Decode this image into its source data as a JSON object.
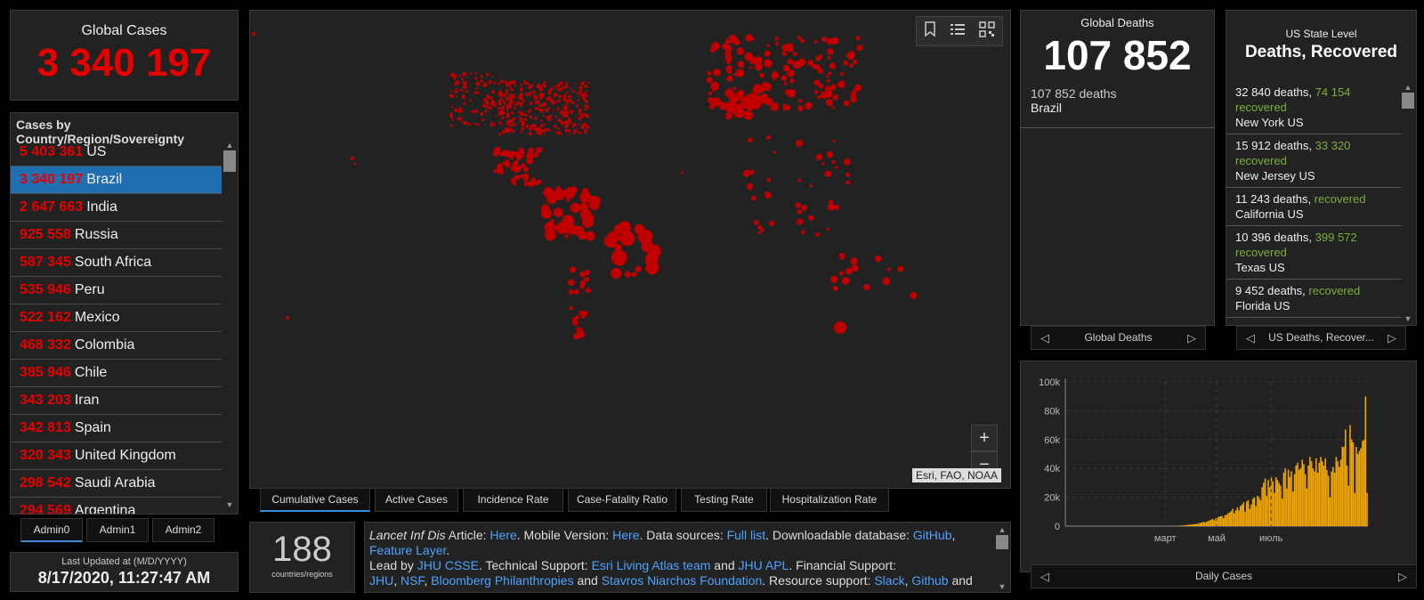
{
  "global_cases": {
    "label": "Global Cases",
    "value": "3 340 197"
  },
  "country_list": {
    "header": "Cases by Country/Region/Sovereignty",
    "items": [
      {
        "count": "5 403 361",
        "name": "US"
      },
      {
        "count": "3 340 197",
        "name": "Brazil",
        "selected": true
      },
      {
        "count": "2 647 663",
        "name": "India"
      },
      {
        "count": "925 558",
        "name": "Russia"
      },
      {
        "count": "587 345",
        "name": "South Africa"
      },
      {
        "count": "535 946",
        "name": "Peru"
      },
      {
        "count": "522 162",
        "name": "Mexico"
      },
      {
        "count": "468 332",
        "name": "Colombia"
      },
      {
        "count": "385 946",
        "name": "Chile"
      },
      {
        "count": "343 203",
        "name": "Iran"
      },
      {
        "count": "342 813",
        "name": "Spain"
      },
      {
        "count": "320 343",
        "name": "United Kingdom"
      },
      {
        "count": "298 542",
        "name": "Saudi Arabia"
      },
      {
        "count": "294 569",
        "name": "Argentina"
      }
    ]
  },
  "admin_tabs": [
    "Admin0",
    "Admin1",
    "Admin2"
  ],
  "last_updated": {
    "label": "Last Updated at (M/D/YYYY)",
    "value": "8/17/2020, 11:27:47 AM"
  },
  "map": {
    "attribution": "Esri, FAO, NOAA",
    "zoom_in": "+",
    "zoom_out": "−",
    "tabs": [
      "Cumulative Cases",
      "Active Cases",
      "Incidence Rate",
      "Case-Fatality Ratio",
      "Testing Rate",
      "Hospitalization Rate"
    ],
    "active_tab": 0
  },
  "countries_count": {
    "value": "188",
    "label": "countries/regions"
  },
  "info": {
    "t1": "Lancet Inf Dis",
    "t2": " Article: ",
    "l1": "Here",
    "t3": ". Mobile Version: ",
    "l2": "Here",
    "t4": ". Data sources: ",
    "l3": "Full list",
    "t5": ". Downloadable database: ",
    "l4": "GitHub",
    "t6": ", ",
    "l5": "Feature Layer",
    "t7": ".",
    "t8": "Lead by ",
    "l6": "JHU CSSE",
    "t9": ". Technical Support: ",
    "l7": "Esri Living Atlas team",
    "t10": " and ",
    "l8": "JHU APL",
    "t11": ". Financial Support:",
    "l9": "JHU",
    "t12": ", ",
    "l10": "NSF",
    "t13": ", ",
    "l11": "Bloomberg Philanthropies",
    "t14": " and ",
    "l12": "Stavros Niarchos Foundation",
    "t15": ". Resource support: ",
    "l13": "Slack",
    "t16": ", ",
    "l14": "Github",
    "t17": " and"
  },
  "global_deaths": {
    "label": "Global Deaths",
    "value": "107 852",
    "detail_count": "107 852 deaths",
    "detail_country": "Brazil",
    "pager_label": "Global Deaths"
  },
  "us_state": {
    "label": "US State Level",
    "title": "Deaths, Recovered",
    "items": [
      {
        "deaths": "32 840 deaths, ",
        "recovered": "74 154 recovered",
        "place": "New York US"
      },
      {
        "deaths": "15 912 deaths, ",
        "recovered": "33 320 recovered",
        "place": "New Jersey US"
      },
      {
        "deaths": "11 243 deaths, ",
        "recovered": " recovered",
        "place": "California US"
      },
      {
        "deaths": "10 396 deaths, ",
        "recovered": "399 572 recovered",
        "place": "Texas US"
      },
      {
        "deaths": "9 452 deaths, ",
        "recovered": " recovered",
        "place": "Florida US"
      }
    ],
    "pager_label": "US Deaths, Recover..."
  },
  "chart_pager_label": "Daily Cases",
  "colors": {
    "accent_red": "#e60000",
    "bar": "#f5a800",
    "link": "#4da3ff",
    "recovered": "#7ab03a",
    "tab_active": "#3b8ddb"
  },
  "icons": [
    "bookmark-icon",
    "legend-list-icon",
    "qr-grid-icon",
    "chevron-left-icon",
    "chevron-right-icon"
  ],
  "chart_data": {
    "type": "bar",
    "y_ticks": [
      "0",
      "20k",
      "40k",
      "60k",
      "80k",
      "100k"
    ],
    "x_ticks": [
      "март",
      "май",
      "июль"
    ],
    "ylim": [
      0,
      100000
    ],
    "values": [
      0,
      0,
      0,
      0,
      0,
      0,
      0,
      0,
      0,
      0,
      0,
      0,
      0,
      0,
      0,
      0,
      0,
      0,
      0,
      0,
      0,
      0,
      0,
      0,
      0,
      0,
      0,
      0,
      0,
      0,
      0,
      0,
      0,
      0,
      0,
      0,
      0,
      0,
      0,
      0,
      0,
      0,
      0,
      0,
      0,
      0,
      0,
      0,
      0,
      0,
      0,
      0,
      0,
      0,
      0,
      0,
      0,
      0,
      0,
      0,
      0,
      0,
      0,
      0,
      0,
      0,
      0,
      0,
      0,
      0,
      50,
      100,
      150,
      200,
      300,
      400,
      500,
      600,
      700,
      900,
      1000,
      1100,
      1300,
      1500,
      1300,
      1700,
      2000,
      2200,
      2500,
      3000,
      2500,
      3000,
      3500,
      4000,
      4500,
      5000,
      4000,
      5500,
      6000,
      6500,
      6800,
      7000,
      5500,
      7500,
      8000,
      9000,
      9500,
      10500,
      12000,
      9000,
      11000,
      13000,
      11000,
      14000,
      15000,
      16500,
      10000,
      17000,
      18000,
      12000,
      15000,
      19000,
      20000,
      14000,
      21000,
      20000,
      18000,
      27000,
      30000,
      33000,
      21000,
      32000,
      27000,
      34000,
      31000,
      23000,
      34000,
      32000,
      30000,
      28000,
      19000,
      37000,
      40000,
      26000,
      39000,
      34000,
      38000,
      24000,
      36000,
      42000,
      44000,
      39000,
      40000,
      46000,
      43000,
      36000,
      26000,
      42000,
      48000,
      45000,
      40000,
      38000,
      47000,
      37000,
      44000,
      48000,
      45000,
      42000,
      47000,
      39000,
      35000,
      20000,
      38000,
      41000,
      37000,
      48000,
      45000,
      41000,
      46000,
      55000,
      55000,
      67000,
      42000,
      28000,
      70000,
      60000,
      58000,
      23000,
      55000,
      50000,
      52000,
      54000,
      59000,
      60000,
      90000,
      23000
    ]
  }
}
